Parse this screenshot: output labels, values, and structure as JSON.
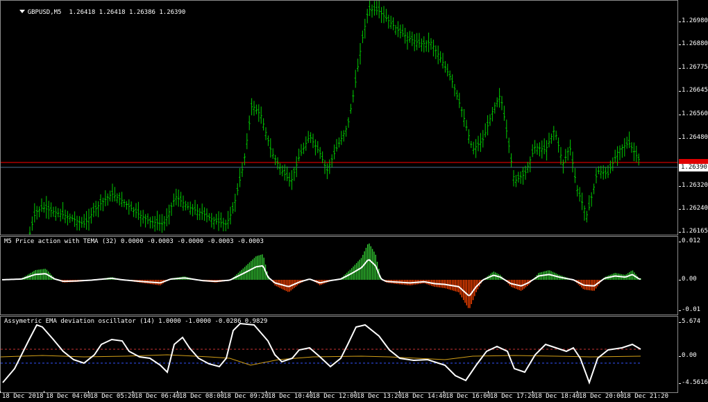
{
  "main_chart": {
    "symbol_label": "GBPUSD,M5",
    "ohlc": "1.26418 1.26418 1.26386 1.26390",
    "price_ticks": [
      "1.26980",
      "1.26880",
      "1.26775",
      "1.26645",
      "1.26560",
      "1.26480",
      "1.26390",
      "1.26320",
      "1.26240",
      "1.26165"
    ],
    "current_price": "1.26390",
    "bid_line_color": "#4f6f8f",
    "ask_line_color": "#ff0000",
    "bar_color": "#00cc00"
  },
  "indicator1": {
    "label": "M5 Price action with TEMA (32) 0.0000 -0.0003 -0.0000 -0.0003 -0.0003",
    "ticks": [
      "0.012",
      "0.00",
      "-0.01"
    ],
    "up_color": "#33cc33",
    "down_color": "#ff4400"
  },
  "indicator2": {
    "label": "Assymetric EMA deviation oscillator (14) 1.0000 -1.0000 -0.0286 0.9829",
    "ticks": [
      "5.674",
      "0.00",
      "-4.5616"
    ],
    "main_line_color": "#ffffff",
    "signal_line_color": "#d4a017",
    "upper_level_color": "#cc3333",
    "lower_level_color": "#3355ff"
  },
  "time_axis": [
    "18 Dec 2018",
    "18 Dec 04:00",
    "18 Dec 05:20",
    "18 Dec 06:40",
    "18 Dec 08:00",
    "18 Dec 09:20",
    "18 Dec 10:40",
    "18 Dec 12:00",
    "18 Dec 13:20",
    "18 Dec 14:40",
    "18 Dec 16:00",
    "18 Dec 17:20",
    "18 Dec 18:40",
    "18 Dec 20:00",
    "18 Dec 21:20"
  ]
}
